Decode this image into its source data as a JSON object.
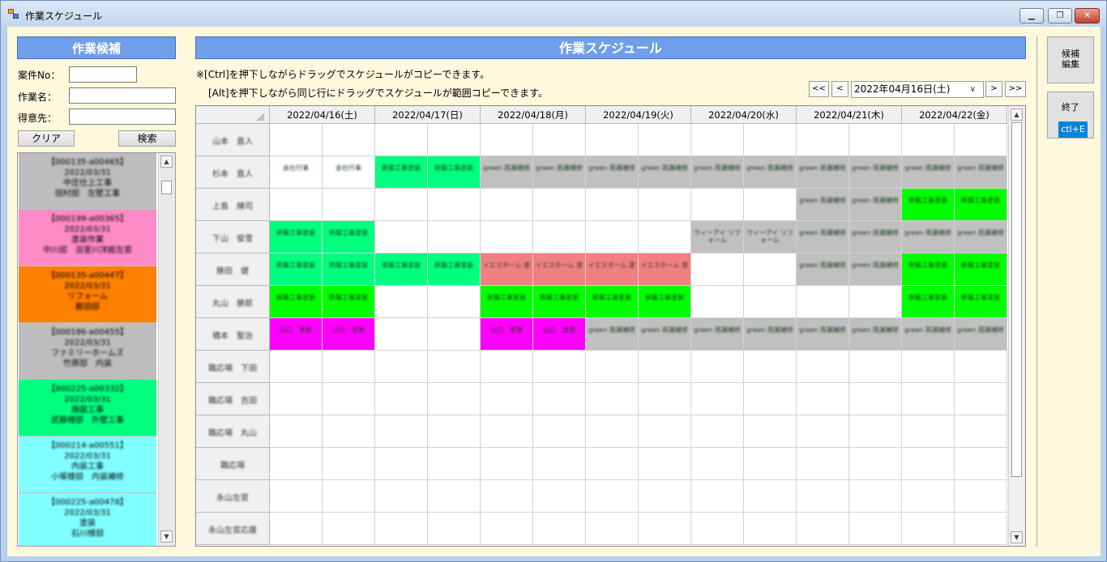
{
  "window": {
    "title": "作業スケジュール",
    "min_icon": "minimize-icon",
    "max_icon": "restore-icon",
    "close_icon": "close-icon"
  },
  "left_panel": {
    "title": "作業候補",
    "fields": [
      {
        "label": "案件No：",
        "value": ""
      },
      {
        "label": "作業名：",
        "value": ""
      },
      {
        "label": "得意先：",
        "value": ""
      }
    ],
    "clear_label": "クリア",
    "search_label": "検索",
    "candidates": [
      {
        "color": "#bdbdbd",
        "lines": [
          "【000135-a00465】",
          "2022/03/31",
          "中庄仕上工事",
          "田村邸　左壁工事"
        ]
      },
      {
        "color": "#ff8ac8",
        "lines": [
          "【000199-a00365】",
          "2022/03/31",
          "塗装作業",
          "中川邸　浴室川洋館左官"
        ]
      },
      {
        "color": "#ff7f00",
        "lines": [
          "【000135-a00447】",
          "2022/03/31",
          "リフォーム",
          "藤田邸"
        ]
      },
      {
        "color": "#bdbdbd",
        "lines": [
          "【000186-a00455】",
          "2022/03/31",
          "ファミリーホームズ",
          "竹原邸　内装"
        ]
      },
      {
        "color": "#00ff7f",
        "lines": [
          "【000225-a00332】",
          "2022/03/31",
          "施設工事",
          "武藤様邸　外壁工事"
        ]
      },
      {
        "color": "#7fffff",
        "lines": [
          "【000214-a00551】",
          "2022/03/31",
          "内装工事",
          "小塚様邸　内装補修"
        ]
      },
      {
        "color": "#7fffff",
        "lines": [
          "【000225-a00478】",
          "2022/03/31",
          "塗装",
          "石川様邸"
        ]
      }
    ]
  },
  "schedule": {
    "title": "作業スケジュール",
    "note1": "※[Ctrl]を押下しながらドラッグでスケジュールがコピーできます。",
    "note2": "[Alt]を押下しながら同じ行にドラッグでスケジュールが範囲コピーできます。",
    "nav": {
      "first": "<<",
      "prev": "<",
      "next": ">",
      "last": ">>"
    },
    "date_value": "2022年04月16日(土)",
    "dates": [
      "2022/04/16(土)",
      "2022/04/17(日)",
      "2022/04/18(月)",
      "2022/04/19(火)",
      "2022/04/20(水)",
      "2022/04/21(木)",
      "2022/04/22(金)"
    ],
    "workers": [
      "山本　直人",
      "杉本　直人",
      "上島　練司",
      "下山　俊雪",
      "勝田　健",
      "丸山　勝郎",
      "橋本　聖治",
      "職応場　下田",
      "職応場　吉田",
      "職応場　丸山",
      "職応場",
      "永山左官",
      "永山左官応援"
    ],
    "rows": [
      [
        null,
        null,
        null,
        null,
        null,
        null,
        null,
        null,
        null,
        null,
        null,
        null,
        null,
        null
      ],
      [
        {
          "c": "#ffffff",
          "t": "会社行事"
        },
        {
          "c": "#ffffff",
          "t": "会社行事"
        },
        {
          "c": "#00ff7f",
          "t": "新築工事塗装"
        },
        {
          "c": "#00ff7f",
          "t": "新築工事塗装"
        },
        {
          "c": "#c0c0c0",
          "t": "green 雨漏補修"
        },
        {
          "c": "#c0c0c0",
          "t": "green 雨漏補修"
        },
        {
          "c": "#c0c0c0",
          "t": "green 雨漏補修"
        },
        {
          "c": "#c0c0c0",
          "t": "green 雨漏補修"
        },
        {
          "c": "#c0c0c0",
          "t": "green 雨漏補修"
        },
        {
          "c": "#c0c0c0",
          "t": "green 雨漏補修"
        },
        {
          "c": "#c0c0c0",
          "t": "green 雨漏補修"
        },
        {
          "c": "#c0c0c0",
          "t": "green 雨漏補修"
        },
        {
          "c": "#c0c0c0",
          "t": "green 雨漏補修"
        },
        {
          "c": "#c0c0c0",
          "t": "green 雨漏補修"
        }
      ],
      [
        null,
        null,
        null,
        null,
        null,
        null,
        null,
        null,
        null,
        null,
        {
          "c": "#c0c0c0",
          "t": "green 雨漏補修"
        },
        {
          "c": "#c0c0c0",
          "t": "green 雨漏補修"
        },
        {
          "c": "#00ff00",
          "t": "新築工事塗装"
        },
        {
          "c": "#00ff00",
          "t": "新築工事塗装"
        }
      ],
      [
        {
          "c": "#00ff7f",
          "t": "新築工事塗装"
        },
        {
          "c": "#00ff7f",
          "t": "新築工事塗装"
        },
        null,
        null,
        null,
        null,
        null,
        null,
        {
          "c": "#c0c0c0",
          "t": "ウィーアイ リフォーム"
        },
        {
          "c": "#c0c0c0",
          "t": "ウィーアイ リフォーム"
        },
        {
          "c": "#c0c0c0",
          "t": "green 雨漏補修"
        },
        {
          "c": "#c0c0c0",
          "t": "green 雨漏補修"
        },
        {
          "c": "#c0c0c0",
          "t": "green 雨漏補修"
        },
        {
          "c": "#c0c0c0",
          "t": "green 雨漏補修"
        }
      ],
      [
        {
          "c": "#00ff7f",
          "t": "新築工事塗装"
        },
        {
          "c": "#00ff7f",
          "t": "新築工事塗装"
        },
        {
          "c": "#00ff7f",
          "t": "新築工事塗装"
        },
        {
          "c": "#00ff7f",
          "t": "新築工事塗装"
        },
        {
          "c": "#f08080",
          "t": "イエスホーム 塗"
        },
        {
          "c": "#f08080",
          "t": "イエスホーム 塗"
        },
        {
          "c": "#f08080",
          "t": "イエスホーム 塗"
        },
        {
          "c": "#f08080",
          "t": "イエスホーム 塗"
        },
        null,
        null,
        {
          "c": "#c0c0c0",
          "t": "green 雨漏補修"
        },
        {
          "c": "#c0c0c0",
          "t": "green 雨漏補修"
        },
        {
          "c": "#00ff00",
          "t": "新築工事塗装"
        },
        {
          "c": "#00ff00",
          "t": "新築工事塗装"
        }
      ],
      [
        {
          "c": "#00ff00",
          "t": "新築工事塗装"
        },
        {
          "c": "#00ff00",
          "t": "新築工事塗装"
        },
        null,
        null,
        {
          "c": "#00ff00",
          "t": "新築工事塗装"
        },
        {
          "c": "#00ff00",
          "t": "新築工事塗装"
        },
        {
          "c": "#00ff00",
          "t": "新築工事塗装"
        },
        {
          "c": "#00ff00",
          "t": "新築工事塗装"
        },
        null,
        null,
        null,
        null,
        {
          "c": "#00ff00",
          "t": "新築工事塗装"
        },
        {
          "c": "#00ff00",
          "t": "新築工事塗装"
        }
      ],
      [
        {
          "c": "#ff00ff",
          "t": "山口　塗装"
        },
        {
          "c": "#ff00ff",
          "t": "山口　塗装"
        },
        null,
        null,
        {
          "c": "#ff00ff",
          "t": "山口　塗装"
        },
        {
          "c": "#ff00ff",
          "t": "山口　塗装"
        },
        {
          "c": "#c0c0c0",
          "t": "green 雨漏補修"
        },
        {
          "c": "#c0c0c0",
          "t": "green 雨漏補修"
        },
        {
          "c": "#c0c0c0",
          "t": "green 雨漏補修"
        },
        {
          "c": "#c0c0c0",
          "t": "green 雨漏補修"
        },
        {
          "c": "#c0c0c0",
          "t": "green 雨漏補修"
        },
        {
          "c": "#c0c0c0",
          "t": "green 雨漏補修"
        },
        {
          "c": "#c0c0c0",
          "t": "green 雨漏補修"
        },
        {
          "c": "#c0c0c0",
          "t": "green 雨漏補修"
        }
      ],
      [
        null,
        null,
        null,
        null,
        null,
        null,
        null,
        null,
        null,
        null,
        null,
        null,
        null,
        null
      ],
      [
        null,
        null,
        null,
        null,
        null,
        null,
        null,
        null,
        null,
        null,
        null,
        null,
        null,
        null
      ],
      [
        null,
        null,
        null,
        null,
        null,
        null,
        null,
        null,
        null,
        null,
        null,
        null,
        null,
        null
      ],
      [
        null,
        null,
        null,
        null,
        null,
        null,
        null,
        null,
        null,
        null,
        null,
        null,
        null,
        null
      ],
      [
        null,
        null,
        null,
        null,
        null,
        null,
        null,
        null,
        null,
        null,
        null,
        null,
        null,
        null
      ],
      [
        null,
        null,
        null,
        null,
        null,
        null,
        null,
        null,
        null,
        null,
        null,
        null,
        null,
        null
      ]
    ]
  },
  "side": {
    "edit_label": "候補\n編集",
    "exit_label": "終了",
    "exit_shortcut": "ctl+E"
  }
}
